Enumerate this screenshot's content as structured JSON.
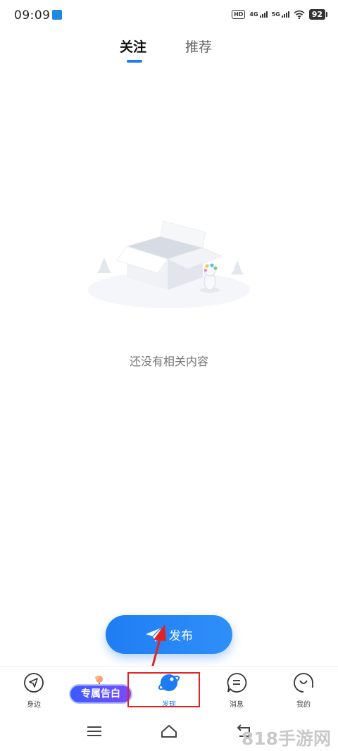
{
  "status_bar": {
    "time": "09:09",
    "network_a": "4G",
    "network_b": "5G",
    "hd": "HD",
    "battery": "92"
  },
  "tabs": [
    {
      "label": "关注",
      "active": true
    },
    {
      "label": "推荐",
      "active": false
    }
  ],
  "empty_state": {
    "message": "还没有相关内容"
  },
  "publish_button": {
    "label": "发布"
  },
  "promo": {
    "label": "专属告白"
  },
  "bottom_nav": [
    {
      "label": "身边",
      "icon": "navigation-arrow-icon"
    },
    {
      "label": "发现",
      "icon": "planet-icon",
      "active": true
    },
    {
      "label": "消息",
      "icon": "message-bubble-icon"
    },
    {
      "label": "我的",
      "icon": "smiley-face-icon"
    }
  ],
  "watermark": "818手游网",
  "colors": {
    "accent": "#1e7cf2",
    "highlight": "#e02424"
  }
}
